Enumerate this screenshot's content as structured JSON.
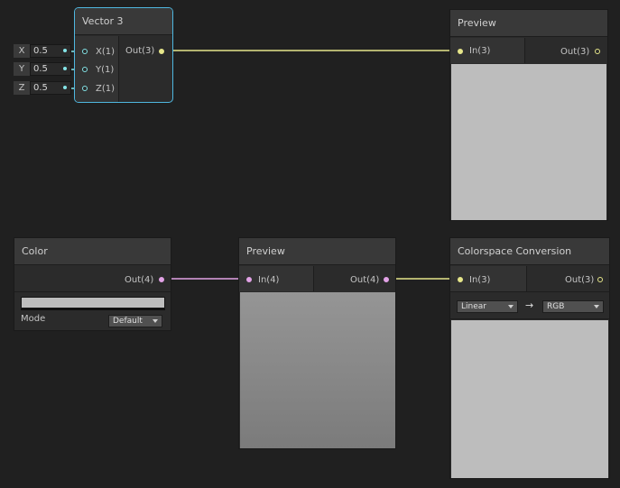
{
  "vector3": {
    "title": "Vector 3",
    "output": "Out(3)",
    "inputs": [
      {
        "axis": "X",
        "value": "0.5",
        "port": "X(1)"
      },
      {
        "axis": "Y",
        "value": "0.5",
        "port": "Y(1)"
      },
      {
        "axis": "Z",
        "value": "0.5",
        "port": "Z(1)"
      }
    ]
  },
  "preview_top": {
    "title": "Preview",
    "input": "In(3)",
    "output": "Out(3)"
  },
  "color_node": {
    "title": "Color",
    "output": "Out(4)",
    "mode_label": "Mode",
    "mode_value": "Default"
  },
  "preview_mid": {
    "title": "Preview",
    "input": "In(4)",
    "output": "Out(4)"
  },
  "colorspace": {
    "title": "Colorspace Conversion",
    "input": "In(3)",
    "output": "Out(3)",
    "from": "Linear",
    "arrow": "→",
    "to": "RGB"
  },
  "colors": {
    "vector3_wire": "#e6e68a",
    "vector4_wire": "#e2a2e6",
    "float_port": "#84e4e7",
    "selection": "#4fb7e0"
  }
}
